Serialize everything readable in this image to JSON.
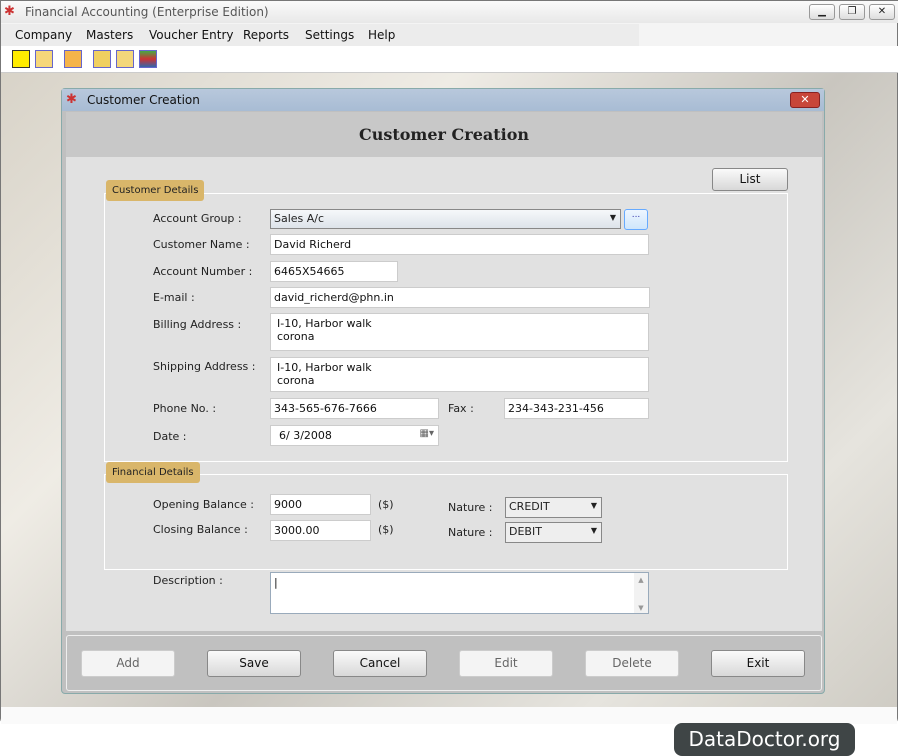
{
  "app": {
    "title": "Financial Accounting (Enterprise Edition)",
    "window_buttons": [
      "minimize",
      "restore",
      "close"
    ]
  },
  "menu": [
    "Company",
    "Masters",
    "Voucher Entry",
    "Reports",
    "Settings",
    "Help"
  ],
  "toolbar": [
    "new-icon",
    "open-icon",
    "calculator-icon",
    "balance-icon",
    "ledger-icon",
    "list-icon"
  ],
  "dialog": {
    "title": "Customer Creation",
    "heading": "Customer Creation",
    "close": "✕",
    "list_button": "List"
  },
  "customer_details": {
    "legend": "Customer Details",
    "account_group_label": "Account Group :",
    "account_group": "Sales A/c",
    "browse": "...",
    "customer_name_label": "Customer Name :",
    "customer_name": "David Richerd",
    "account_number_label": "Account Number :",
    "account_number": "6465X54665",
    "email_label": "E-mail :",
    "email": "david_richerd@phn.in",
    "billing_label": "Billing Address :",
    "billing": "I-10, Harbor walk\ncorona",
    "shipping_label": "Shipping Address :",
    "shipping": "I-10, Harbor walk\ncorona",
    "phone_label": "Phone No. :",
    "phone": "343-565-676-7666",
    "fax_label": "Fax :",
    "fax": "234-343-231-456",
    "date_label": "Date :",
    "date": "6/  3/2008"
  },
  "financial_details": {
    "legend": "Financial Details",
    "opening_label": "Opening Balance :",
    "opening": "9000",
    "currency": "($)",
    "closing_label": "Closing Balance :",
    "closing": "3000.00",
    "nature_label": "Nature :",
    "nature_opening": "CREDIT",
    "nature_closing": "DEBIT"
  },
  "description_label": "Description :",
  "description": "",
  "buttons": {
    "add": "Add",
    "save": "Save",
    "cancel": "Cancel",
    "edit": "Edit",
    "delete": "Delete",
    "exit": "Exit"
  },
  "watermark": "DataDoctor.org"
}
